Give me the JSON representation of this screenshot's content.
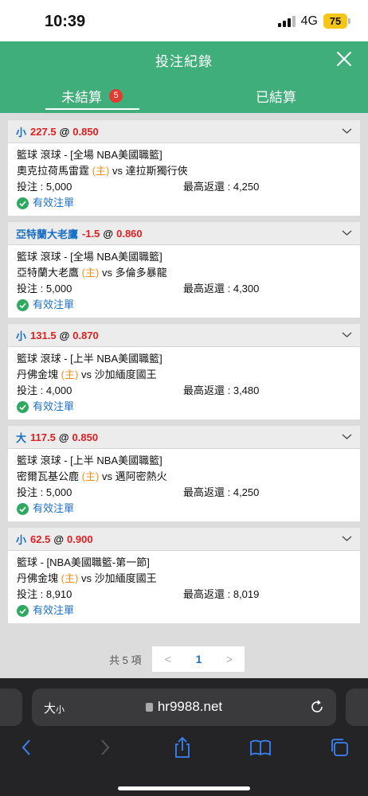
{
  "status": {
    "time": "10:39",
    "network": "4G",
    "battery": "75"
  },
  "header": {
    "title": "投注紀錄"
  },
  "tabs": [
    {
      "label": "未結算",
      "badge": "5"
    },
    {
      "label": "已結算"
    }
  ],
  "bets": [
    {
      "selection": "小",
      "line": "227.5",
      "at": "@",
      "odds": "0.850",
      "league": "籃球 滾球 - [全場 NBA美國職籃]",
      "home": "奧克拉荷馬雷霆",
      "host_tag": "(主)",
      "vs": "vs",
      "away": "達拉斯獨行俠",
      "stake_label": "投注 : 5,000",
      "payout_label": "最高返還 : 4,250",
      "status": "有效注單"
    },
    {
      "selection": "亞特蘭大老鷹",
      "line": "-1.5",
      "at": "@",
      "odds": "0.860",
      "league": "籃球 滾球 - [全場 NBA美國職籃]",
      "home": "亞特蘭大老鷹",
      "host_tag": "(主)",
      "vs": "vs",
      "away": "多倫多暴龍",
      "stake_label": "投注 : 5,000",
      "payout_label": "最高返還 : 4,300",
      "status": "有效注單"
    },
    {
      "selection": "小",
      "line": "131.5",
      "at": "@",
      "odds": "0.870",
      "league": "籃球 滾球 - [上半 NBA美國職籃]",
      "home": "丹佛金塊",
      "host_tag": "(主)",
      "vs": "vs",
      "away": "沙加緬度國王",
      "stake_label": "投注 : 4,000",
      "payout_label": "最高返還 : 3,480",
      "status": "有效注單"
    },
    {
      "selection": "大",
      "line": "117.5",
      "at": "@",
      "odds": "0.850",
      "league": "籃球 滾球 - [上半 NBA美國職籃]",
      "home": "密爾瓦基公鹿",
      "host_tag": "(主)",
      "vs": "vs",
      "away": "邁阿密熱火",
      "stake_label": "投注 : 5,000",
      "payout_label": "最高返還 : 4,250",
      "status": "有效注單"
    },
    {
      "selection": "小",
      "line": "62.5",
      "at": "@",
      "odds": "0.900",
      "league": "籃球 - [NBA美國職籃-第一節]",
      "home": "丹佛金塊",
      "host_tag": "(主)",
      "vs": "vs",
      "away": "沙加緬度國王",
      "stake_label": "投注 : 8,910",
      "payout_label": "最高返還 : 8,019",
      "status": "有效注單"
    }
  ],
  "pager": {
    "total": "共 5 項",
    "prev": "<",
    "page": "1",
    "next": ">"
  },
  "browser": {
    "text_size": "大",
    "text_size_small": "小",
    "url": "hr9988.net"
  },
  "colors": {
    "header_green": "#3fae7a",
    "badge_red": "#e23a2e",
    "selection_blue": "#1a6ec5",
    "odds_red": "#e02020",
    "host_orange": "#f0901a"
  }
}
